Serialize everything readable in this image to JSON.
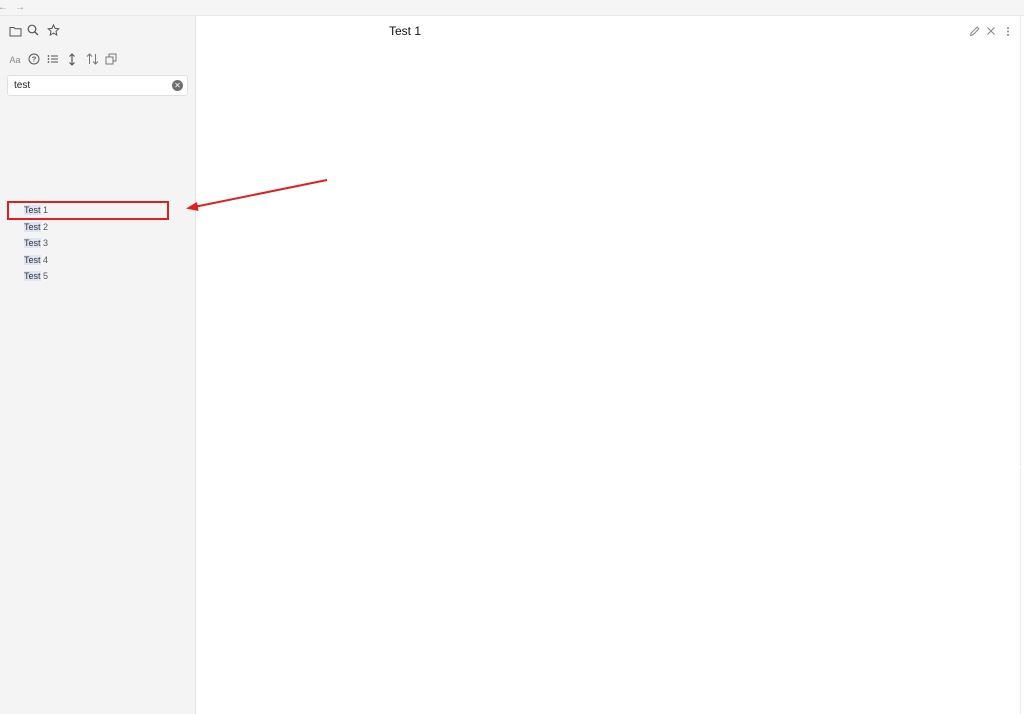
{
  "topbar": {
    "back_icon": "arrow-left-icon",
    "forward_icon": "arrow-right-icon",
    "back_glyph": "←",
    "forward_glyph": "→"
  },
  "sidebar": {
    "nav_icons": [
      "folder-icon",
      "search-icon",
      "star-icon"
    ],
    "search_options_icons": [
      "match-case-icon",
      "help-icon",
      "list-icon",
      "expand-vertical-icon",
      "sort-icon",
      "copy-icon"
    ],
    "match_case_label": "Aa",
    "search": {
      "value": "test",
      "clear_glyph": "✕"
    },
    "results": [
      {
        "match": "Test",
        "rest": " 1"
      },
      {
        "match": "Test",
        "rest": " 2"
      },
      {
        "match": "Test",
        "rest": " 3"
      },
      {
        "match": "Test",
        "rest": " 4"
      },
      {
        "match": "Test",
        "rest": " 5"
      }
    ]
  },
  "main": {
    "title": "Test 1",
    "action_icons": [
      "pencil-icon",
      "close-icon",
      "more-vertical-icon"
    ]
  },
  "annotation": {
    "color": "#e02020"
  }
}
